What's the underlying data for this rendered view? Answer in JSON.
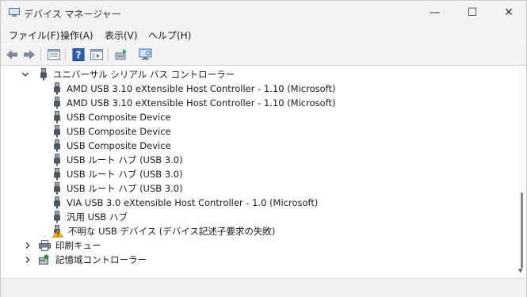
{
  "window": {
    "title": "デバイス マネージャー",
    "controls": {
      "minimize": "—",
      "maximize": "☐",
      "close": "✕"
    }
  },
  "menu": [
    {
      "label": "ファイル(F)"
    },
    {
      "label": "操作(A)"
    },
    {
      "label": "表示(V)"
    },
    {
      "label": "ヘルプ(H)"
    }
  ],
  "toolbar": {
    "buttons": [
      "back-icon",
      "forward-icon",
      "properties-icon",
      "help-icon",
      "console-tree-icon",
      "update-driver-icon",
      "scan-hardware-icon"
    ]
  },
  "tree": {
    "category_usb": "ユニバーサル シリアル バス コントローラー",
    "devices": [
      {
        "label": "AMD USB 3.10 eXtensible Host Controller - 1.10 (Microsoft)",
        "icon": "usb-plug-icon"
      },
      {
        "label": "AMD USB 3.10 eXtensible Host Controller - 1.10 (Microsoft)",
        "icon": "usb-plug-icon"
      },
      {
        "label": "USB Composite Device",
        "icon": "usb-plug-icon"
      },
      {
        "label": "USB Composite Device",
        "icon": "usb-plug-icon"
      },
      {
        "label": "USB Composite Device",
        "icon": "usb-plug-icon"
      },
      {
        "label": "USB ルート ハブ (USB 3.0)",
        "icon": "usb-plug-icon"
      },
      {
        "label": "USB ルート ハブ (USB 3.0)",
        "icon": "usb-plug-icon"
      },
      {
        "label": "USB ルート ハブ (USB 3.0)",
        "icon": "usb-plug-icon"
      },
      {
        "label": "VIA USB 3.0 eXtensible Host Controller - 1.0 (Microsoft)",
        "icon": "usb-plug-icon"
      },
      {
        "label": "汎用 USB ハブ",
        "icon": "usb-plug-icon"
      },
      {
        "label": "不明な USB デバイス (デバイス記述子要求の失敗)",
        "icon": "usb-warning-icon"
      }
    ],
    "category_print_queue": "印刷キュー",
    "category_storage": "記憶域コントローラー"
  },
  "colors": {
    "warning": "#f2b400",
    "accent": "#3a6fb5"
  }
}
